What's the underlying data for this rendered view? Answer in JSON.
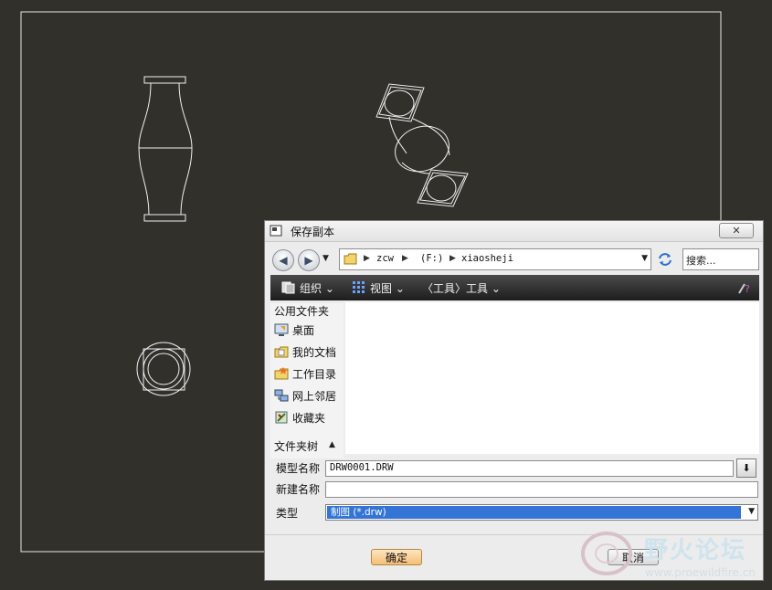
{
  "dialog": {
    "title": "保存副本",
    "close_label": "✕",
    "address_crumbs": [
      "zcw",
      "(F:)",
      "xiaosheji"
    ],
    "search_placeholder": "搜索...",
    "toolbar": {
      "organize": "组织",
      "views": "视图",
      "tools": "〈工具〉工具"
    },
    "left_pane": {
      "header": "公用文件夹",
      "items": [
        {
          "label": "桌面",
          "icon": "desktop-icon"
        },
        {
          "label": "我的文档",
          "icon": "documents-icon"
        },
        {
          "label": "工作目录",
          "icon": "working-dir-icon"
        },
        {
          "label": "网上邻居",
          "icon": "network-icon"
        },
        {
          "label": "收藏夹",
          "icon": "favorites-icon"
        }
      ]
    },
    "folders_toggle": "文件夹树",
    "fields": {
      "model_name_label": "模型名称",
      "model_name_value": "DRW0001.DRW",
      "new_name_label": "新建名称",
      "new_name_value": "",
      "type_label": "类型",
      "type_value": "制图 (*.drw)"
    },
    "ok_label": "确定",
    "cancel_label": "取消"
  },
  "watermark": {
    "text": "野火论坛",
    "url": "www.proewildfire.cn"
  },
  "colors": {
    "background": "#31302b",
    "select_highlight": "#3374d6",
    "ok_button": "#f4be76"
  }
}
